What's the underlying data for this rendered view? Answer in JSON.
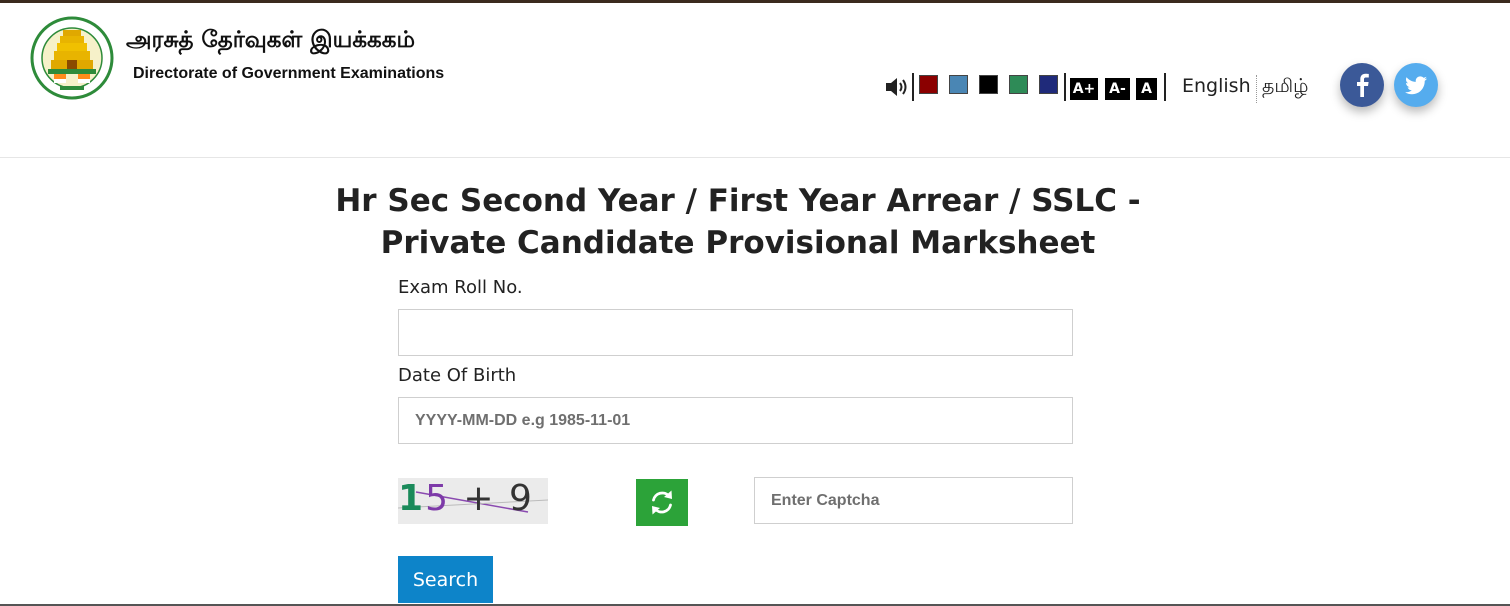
{
  "header": {
    "brand_tamil": "அரசுத் தேர்வுகள் இயக்ககம்",
    "brand_english": "Directorate of Government Examinations",
    "logo_icon": "tamil-nadu-emblem-icon"
  },
  "accessibility": {
    "speaker_icon": "speaker-icon",
    "theme_colors": [
      "#8b0000",
      "#4a86b4",
      "#000000",
      "#2e8b57",
      "#1f2a7a"
    ],
    "font_increase": "A+",
    "font_decrease": "A-",
    "font_reset": "A"
  },
  "languages": {
    "english": "English",
    "tamil": "தமிழ்"
  },
  "social": {
    "facebook_icon": "facebook-icon",
    "twitter_icon": "twitter-icon",
    "facebook_color": "#3b5998",
    "twitter_color": "#55acee"
  },
  "form": {
    "title_line1": "Hr Sec Second Year / First Year Arrear / SSLC -",
    "title_line2": "Private Candidate Provisional Marksheet",
    "roll_label": "Exam Roll No.",
    "roll_value": "",
    "dob_label": "Date Of Birth",
    "dob_placeholder": "YYYY-MM-DD e.g 1985-11-01",
    "captcha_part1": "1",
    "captcha_part2": "5",
    "captcha_part3": " + 9 =",
    "captcha_placeholder": "Enter Captcha",
    "refresh_icon": "refresh-icon",
    "search_label": "Search",
    "accent_color": "#0d84c9"
  }
}
